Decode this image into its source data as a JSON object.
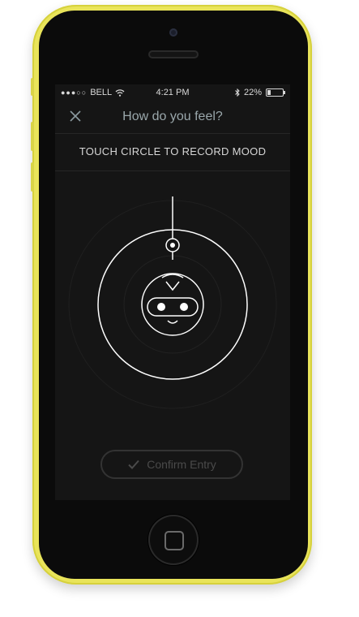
{
  "status_bar": {
    "signal_dots": "●●●○○",
    "carrier": "BELL",
    "time": "4:21 PM",
    "battery_percent": "22%",
    "battery_level": 0.22
  },
  "nav": {
    "title": "How do you feel?"
  },
  "instruction": "TOUCH CIRCLE TO RECORD MOOD",
  "mood": {
    "face": "smiley-robot"
  },
  "confirm_button": {
    "label": "Confirm Entry"
  },
  "colors": {
    "shell": "#e9e45a",
    "screen_bg": "#151515",
    "accent_white": "#ffffff",
    "muted": "#4a4a4a"
  }
}
